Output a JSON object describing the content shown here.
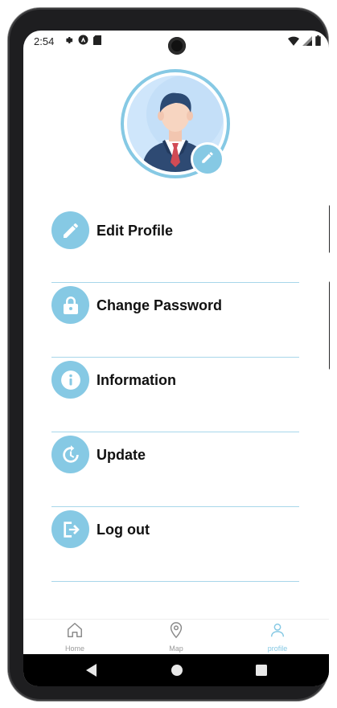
{
  "status_bar": {
    "time": "2:54",
    "left_icons": [
      "gear-icon",
      "a-circle-icon",
      "sd-card-icon"
    ],
    "right_icons": [
      "wifi-icon",
      "signal-icon",
      "battery-icon"
    ]
  },
  "profile": {
    "avatar_icon": "businessman-avatar",
    "edit_icon": "pencil-icon"
  },
  "menu": {
    "items": [
      {
        "label": "Edit Profile",
        "icon": "pencil-icon"
      },
      {
        "label": "Change Password",
        "icon": "lock-icon"
      },
      {
        "label": "Information",
        "icon": "info-icon"
      },
      {
        "label": "Update",
        "icon": "refresh-clock-icon"
      },
      {
        "label": "Log out",
        "icon": "logout-icon"
      }
    ]
  },
  "bottom_nav": {
    "items": [
      {
        "label": "Home",
        "icon": "home-icon"
      },
      {
        "label": "Map",
        "icon": "map-pin-icon"
      },
      {
        "label": "profile",
        "icon": "person-icon"
      }
    ],
    "active": "profile"
  },
  "colors": {
    "accent": "#86c9e4",
    "divider": "#a7d6ea",
    "text": "#111111",
    "inactive": "#9a9a9a"
  }
}
